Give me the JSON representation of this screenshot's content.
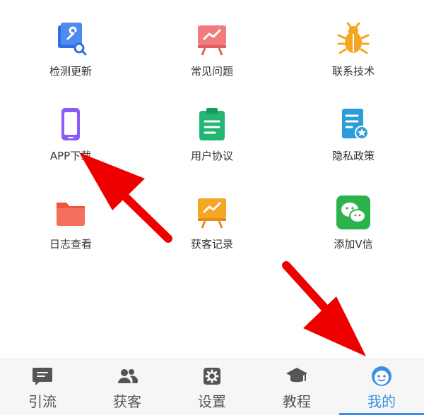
{
  "menu": {
    "items": [
      {
        "label": "检测更新",
        "icon": "wrench-search-icon",
        "color": "#2f6fe0"
      },
      {
        "label": "常见问题",
        "icon": "chart-board-icon",
        "color": "#f07c7c"
      },
      {
        "label": "联系技术",
        "icon": "bug-icon",
        "color": "#f5a623"
      },
      {
        "label": "APP下载",
        "icon": "phone-icon",
        "color": "#8b5cf6"
      },
      {
        "label": "用户协议",
        "icon": "clipboard-icon",
        "color": "#22b573"
      },
      {
        "label": "隐私政策",
        "icon": "document-star-icon",
        "color": "#2d9cdb"
      },
      {
        "label": "日志查看",
        "icon": "folder-icon",
        "color": "#f2543d"
      },
      {
        "label": "获客记录",
        "icon": "chart-board-icon",
        "color": "#f5a623"
      },
      {
        "label": "添加V信",
        "icon": "wechat-icon",
        "color": "#2bb24c"
      }
    ]
  },
  "tabbar": {
    "accent": "#3a8ee6",
    "tabs": [
      {
        "label": "引流",
        "icon": "chat-icon"
      },
      {
        "label": "获客",
        "icon": "users-icon"
      },
      {
        "label": "设置",
        "icon": "gear-icon"
      },
      {
        "label": "教程",
        "icon": "graduation-cap-icon"
      },
      {
        "label": "我的",
        "icon": "smiley-face-icon",
        "active": true
      }
    ]
  }
}
